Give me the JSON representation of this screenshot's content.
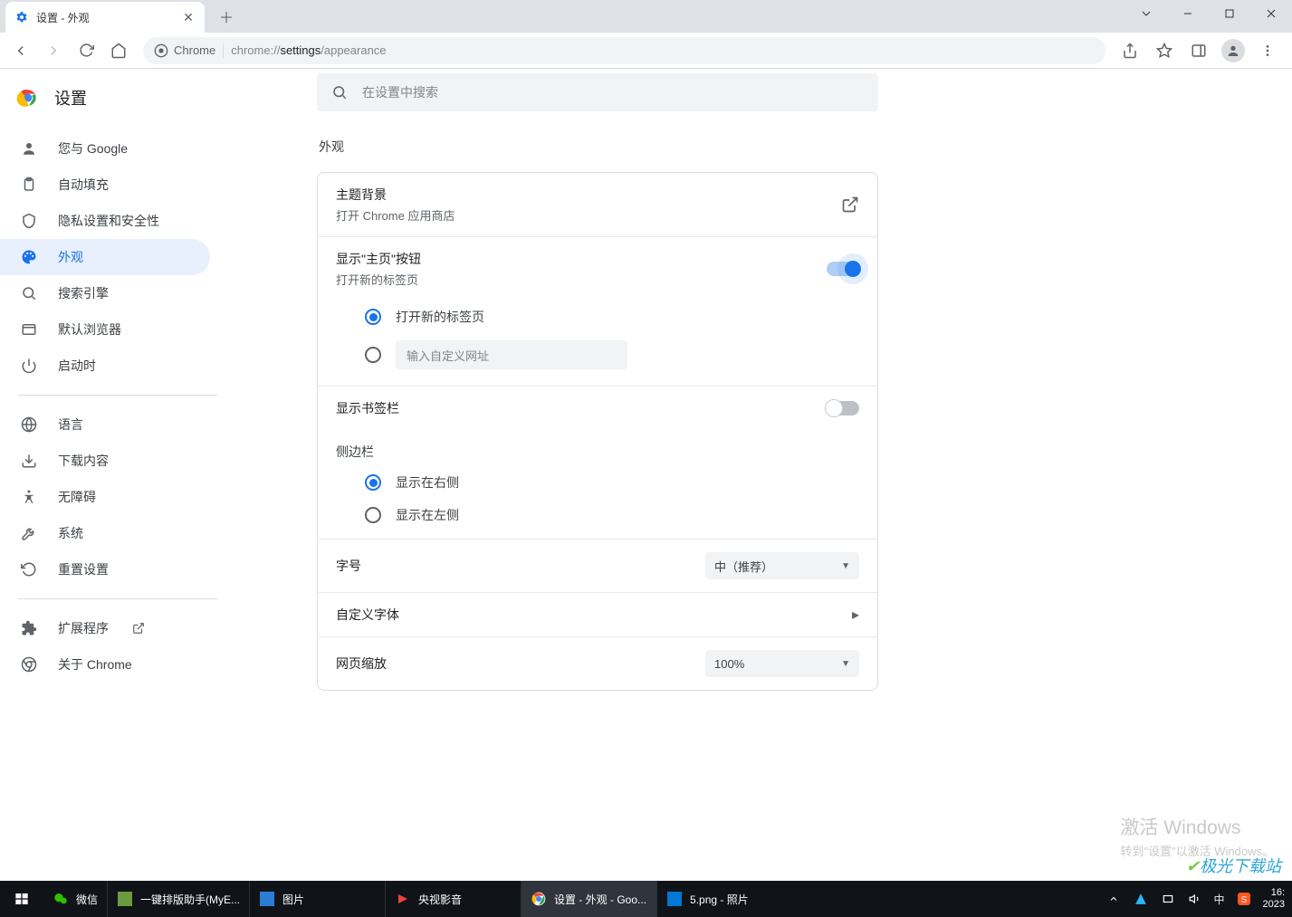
{
  "browser": {
    "tab_title": "设置 - 外观",
    "url_prefix": "Chrome",
    "url_host": "chrome://",
    "url_path_bold": "settings",
    "url_path_rest": "/appearance"
  },
  "page": {
    "title": "设置",
    "search_placeholder": "在设置中搜索"
  },
  "sidebar": {
    "items": [
      {
        "label": "您与 Google"
      },
      {
        "label": "自动填充"
      },
      {
        "label": "隐私设置和安全性"
      },
      {
        "label": "外观"
      },
      {
        "label": "搜索引擎"
      },
      {
        "label": "默认浏览器"
      },
      {
        "label": "启动时"
      }
    ],
    "items2": [
      {
        "label": "语言"
      },
      {
        "label": "下载内容"
      },
      {
        "label": "无障碍"
      },
      {
        "label": "系统"
      },
      {
        "label": "重置设置"
      }
    ],
    "items3": [
      {
        "label": "扩展程序"
      },
      {
        "label": "关于 Chrome"
      }
    ]
  },
  "section": {
    "title": "外观"
  },
  "rows": {
    "theme": {
      "title": "主题背景",
      "sub": "打开 Chrome 应用商店"
    },
    "homebtn": {
      "title": "显示\"主页\"按钮",
      "sub": "打开新的标签页",
      "on": true
    },
    "home_radio1": "打开新的标签页",
    "home_radio2_placeholder": "输入自定义网址",
    "bookmarksbar": {
      "title": "显示书签栏",
      "on": false
    },
    "sidepanel": {
      "title": "侧边栏"
    },
    "sp_radio1": "显示在右侧",
    "sp_radio2": "显示在左侧",
    "fontsize": {
      "title": "字号",
      "value": "中（推荐）"
    },
    "customfont": {
      "title": "自定义字体"
    },
    "zoom": {
      "title": "网页缩放",
      "value": "100%"
    }
  },
  "watermark": {
    "l1": "激活 Windows",
    "l2": "转到\"设置\"以激活 Windows。"
  },
  "sitemark": "极光下载站",
  "taskbar": {
    "items": [
      {
        "label": "微信"
      },
      {
        "label": "一键排版助手(MyE..."
      },
      {
        "label": "图片"
      },
      {
        "label": "央视影音"
      },
      {
        "label": "设置 - 外观 - Goo..."
      },
      {
        "label": "5.png - 照片"
      }
    ],
    "ime": "中",
    "time1": "16:",
    "time2": "2023"
  }
}
